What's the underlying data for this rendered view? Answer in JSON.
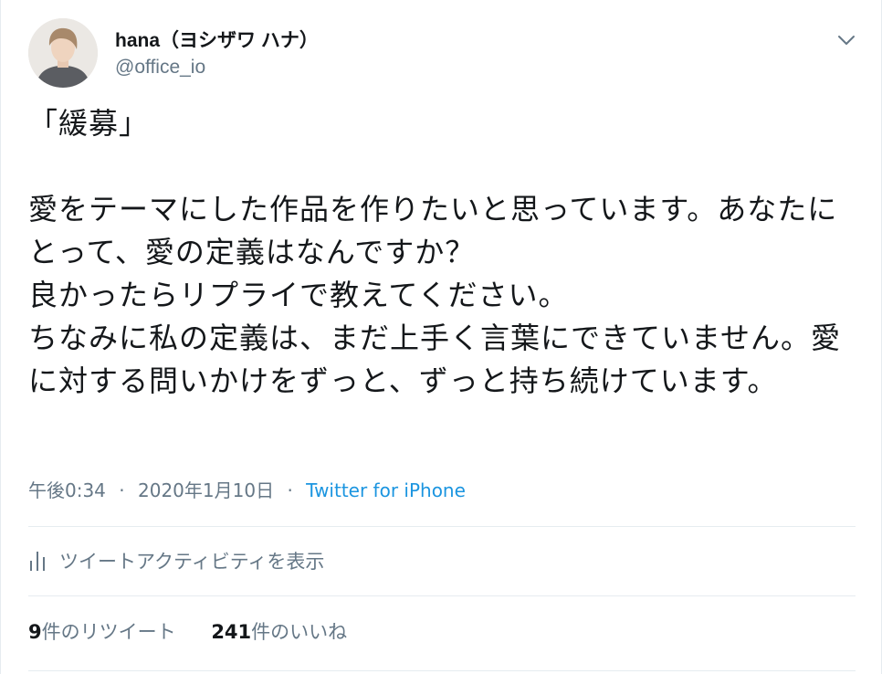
{
  "author": {
    "display_name": "hana（ヨシザワ ハナ）",
    "handle": "@office_io"
  },
  "tweet": {
    "text": "「緩募」\n\n愛をテーマにした作品を作りたいと思っています。あなたにとって、愛の定義はなんですか？\n良かったらリプライで教えてください。\nちなみに私の定義は、まだ上手く言葉にできていません。愛に対する問いかけをずっと、ずっと持ち続けています。"
  },
  "meta": {
    "time": "午後0:34",
    "separator": "·",
    "date": "2020年1月10日",
    "source": "Twitter for iPhone"
  },
  "activity": {
    "label": "ツイートアクティビティを表示",
    "icon": "bar-chart-icon"
  },
  "stats": {
    "retweets_count": "9",
    "retweets_label": "件のリツイート",
    "likes_count": "241",
    "likes_label": "件のいいね"
  },
  "colors": {
    "text": "#14171a",
    "secondary": "#657786",
    "link": "#1b95e0",
    "divider": "#e6ecf0"
  }
}
